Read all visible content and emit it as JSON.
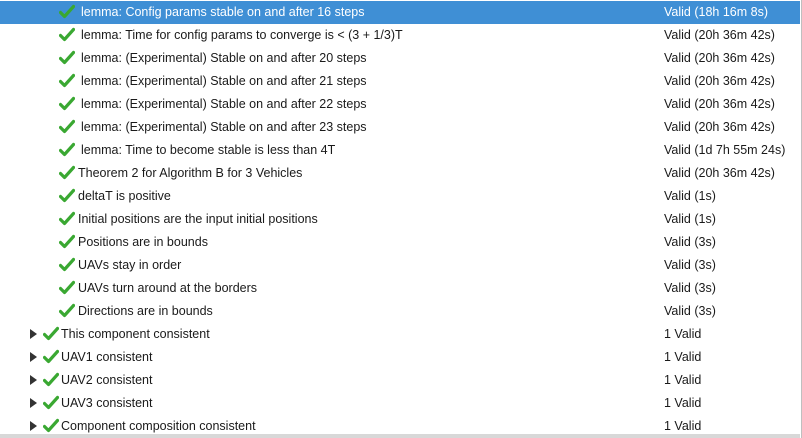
{
  "rows": [
    {
      "label": "lemma: Config params stable on and after 16 steps",
      "status": "Valid (18h 16m 8s)",
      "depth": 2,
      "expandable": false,
      "selected": true
    },
    {
      "label": "lemma: Time for config params to converge is < (3 + 1/3)T",
      "status": "Valid (20h 36m 42s)",
      "depth": 2,
      "expandable": false,
      "selected": false
    },
    {
      "label": "lemma: (Experimental) Stable on and after 20 steps",
      "status": "Valid (20h 36m 42s)",
      "depth": 2,
      "expandable": false,
      "selected": false
    },
    {
      "label": "lemma: (Experimental) Stable on and after 21 steps",
      "status": "Valid (20h 36m 42s)",
      "depth": 2,
      "expandable": false,
      "selected": false
    },
    {
      "label": "lemma: (Experimental) Stable on and after 22 steps",
      "status": "Valid (20h 36m 42s)",
      "depth": 2,
      "expandable": false,
      "selected": false
    },
    {
      "label": "lemma: (Experimental) Stable on and after 23 steps",
      "status": "Valid (20h 36m 42s)",
      "depth": 2,
      "expandable": false,
      "selected": false
    },
    {
      "label": "lemma: Time to become stable is less than 4T",
      "status": "Valid (1d 7h 55m 24s)",
      "depth": 2,
      "expandable": false,
      "selected": false
    },
    {
      "label": "Theorem 2 for Algorithm B for 3 Vehicles",
      "status": "Valid (20h 36m 42s)",
      "depth": 1,
      "expandable": false,
      "selected": false
    },
    {
      "label": "deltaT is positive",
      "status": "Valid (1s)",
      "depth": 1,
      "expandable": false,
      "selected": false
    },
    {
      "label": "Initial positions are the input initial positions",
      "status": "Valid (1s)",
      "depth": 1,
      "expandable": false,
      "selected": false
    },
    {
      "label": "Positions are in bounds",
      "status": "Valid (3s)",
      "depth": 1,
      "expandable": false,
      "selected": false
    },
    {
      "label": "UAVs stay in order",
      "status": "Valid (3s)",
      "depth": 1,
      "expandable": false,
      "selected": false
    },
    {
      "label": "UAVs turn around at the borders",
      "status": "Valid (3s)",
      "depth": 1,
      "expandable": false,
      "selected": false
    },
    {
      "label": "Directions are in bounds",
      "status": "Valid (3s)",
      "depth": 1,
      "expandable": false,
      "selected": false
    },
    {
      "label": "This component consistent",
      "status": "1 Valid",
      "depth": 0,
      "expandable": true,
      "selected": false
    },
    {
      "label": "UAV1 consistent",
      "status": "1 Valid",
      "depth": 0,
      "expandable": true,
      "selected": false
    },
    {
      "label": "UAV2 consistent",
      "status": "1 Valid",
      "depth": 0,
      "expandable": true,
      "selected": false
    },
    {
      "label": "UAV3 consistent",
      "status": "1 Valid",
      "depth": 0,
      "expandable": true,
      "selected": false
    },
    {
      "label": "Component composition consistent",
      "status": "1 Valid",
      "depth": 0,
      "expandable": true,
      "selected": false
    }
  ],
  "icons": {
    "row_status": "checkmark-icon",
    "expander": "expand-arrow-icon"
  },
  "colors": {
    "selection": "#3f8fd5",
    "check": "#3aa832",
    "check_shadow": "#1f6e1a"
  }
}
